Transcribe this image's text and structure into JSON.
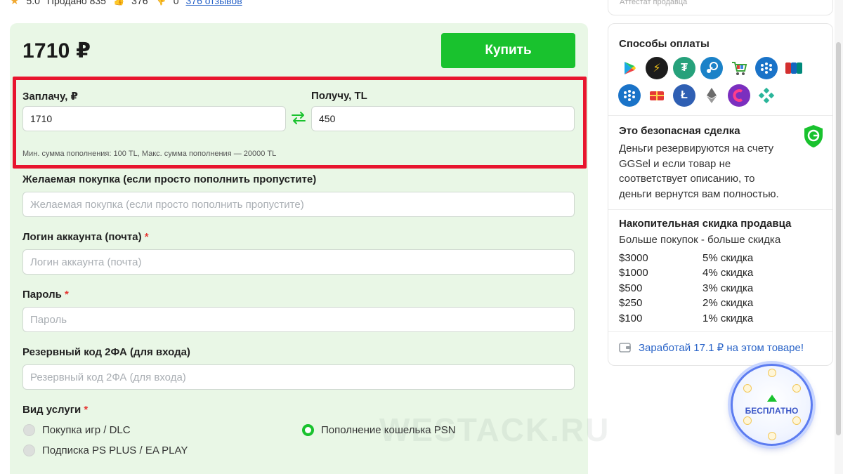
{
  "topbar": {
    "rating": "5.0",
    "sold": "Продано 835",
    "likes": "376",
    "dislikes": "0",
    "reviews_link": "376 отзывов"
  },
  "purchase": {
    "price": "1710 ₽",
    "buy_label": "Купить",
    "pay_label": "Заплачу, ₽",
    "pay_value": "1710",
    "receive_label": "Получу, TL",
    "receive_value": "450",
    "limits_hint": "Мин. сумма пополнения: 100 TL, Макс. сумма пополнения — 20000 TL"
  },
  "form": {
    "desired_label": "Желаемая покупка (если просто пополнить пропустите)",
    "desired_placeholder": "Желаемая покупка (если просто пополнить пропустите)",
    "login_label": "Логин аккаунта (почта)",
    "login_placeholder": "Логин аккаунта (почта)",
    "password_label": "Пароль",
    "password_placeholder": "Пароль",
    "backup_label": "Резервный код 2ФА (для входа)",
    "backup_placeholder": "Резервный код 2ФА (для входа)",
    "service_label": "Вид услуги",
    "required_mark": "*",
    "options": [
      {
        "label": "Покупка игр / DLC",
        "selected": false
      },
      {
        "label": "Подписка PS PLUS / EA PLAY",
        "selected": false
      },
      {
        "label": "Пополнение кошелька PSN",
        "selected": true
      }
    ]
  },
  "watermark": "WESTACK.RU",
  "sidebar": {
    "seller_caption": "Аттестат продавца",
    "payment_title": "Способы оплаты",
    "payment_icons": [
      "google-play-icon",
      "lightning-icon",
      "tether-icon",
      "steam-icon",
      "cart-icon",
      "webmoney-icon",
      "unionpay-icon",
      "webmoney-icon",
      "gift-card-icon",
      "litecoin-icon",
      "ethereum-icon",
      "crypto-icon",
      "payment-icon"
    ],
    "safe_title": "Это безопасная сделка",
    "safe_text_lines": [
      "Деньги резервируются на счету",
      "GGSel и если товар не",
      "соответствует описанию, то",
      "деньги вернутся вам полностью."
    ],
    "discount_title": "Накопительная скидка продавца",
    "discount_subtitle": "Больше покупок - больше скидка",
    "discounts": [
      {
        "amount": "$3000",
        "discount": "5% скидка"
      },
      {
        "amount": "$1000",
        "discount": "4% скидка"
      },
      {
        "amount": "$500",
        "discount": "3% скидка"
      },
      {
        "amount": "$250",
        "discount": "2% скидка"
      },
      {
        "amount": "$100",
        "discount": "1% скидка"
      }
    ],
    "earn_link": "Заработай 17.1 ₽ на этом товаре!"
  },
  "free_badge": "БЕСПЛАТНО",
  "colors": {
    "accent_green": "#19c22e",
    "panel_bg": "#e9f7e6",
    "highlight_red": "#e8152e",
    "link_blue": "#2a64c8"
  }
}
